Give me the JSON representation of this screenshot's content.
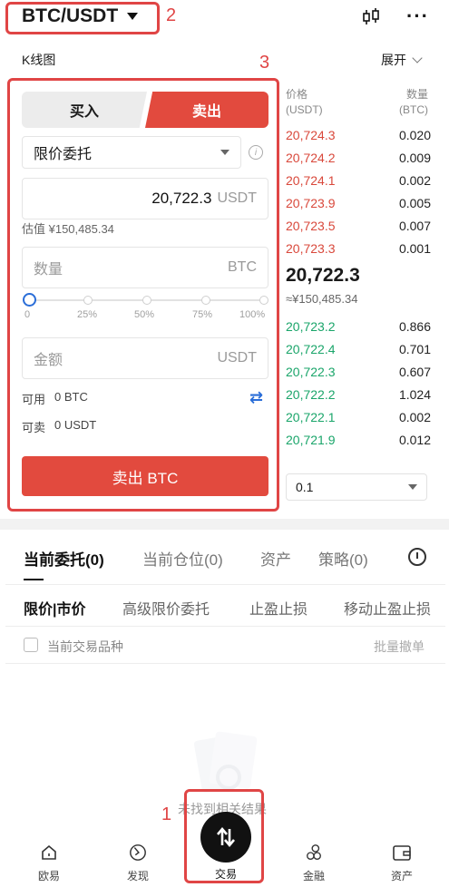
{
  "header": {
    "pair": "BTC/USDT",
    "icons": [
      "candlestick-icon",
      "more-icon"
    ]
  },
  "toolbar": {
    "kline": "K线图",
    "expand": "展开"
  },
  "trade": {
    "tab_buy": "买入",
    "tab_sell": "卖出",
    "order_type": "限价委托",
    "price_value": "20,722.3",
    "price_unit": "USDT",
    "estimate": "估值 ¥150,485.34",
    "qty_placeholder": "数量",
    "qty_unit": "BTC",
    "slider_ticks": [
      "0",
      "25%",
      "50%",
      "75%",
      "100%"
    ],
    "slider_value": 0,
    "amount_placeholder": "金额",
    "amount_unit": "USDT",
    "available_label": "可用",
    "available_value": "0 BTC",
    "sellable_label": "可卖",
    "sellable_value": "0 USDT",
    "submit": "卖出 BTC"
  },
  "orderbook": {
    "price_header": "价格",
    "price_header_unit": "(USDT)",
    "qty_header": "数量",
    "qty_header_unit": "(BTC)",
    "asks": [
      {
        "price": "20,724.3",
        "qty": "0.020"
      },
      {
        "price": "20,724.2",
        "qty": "0.009"
      },
      {
        "price": "20,724.1",
        "qty": "0.002"
      },
      {
        "price": "20,723.9",
        "qty": "0.005"
      },
      {
        "price": "20,723.5",
        "qty": "0.007"
      },
      {
        "price": "20,723.3",
        "qty": "0.001"
      }
    ],
    "last_price": "20,722.3",
    "last_cny": "≈¥150,485.34",
    "bids": [
      {
        "price": "20,723.2",
        "qty": "0.866"
      },
      {
        "price": "20,722.4",
        "qty": "0.701"
      },
      {
        "price": "20,722.3",
        "qty": "0.607"
      },
      {
        "price": "20,722.2",
        "qty": "1.024"
      },
      {
        "price": "20,722.1",
        "qty": "0.002"
      },
      {
        "price": "20,721.9",
        "qty": "0.012"
      }
    ],
    "depth": "0.1"
  },
  "orders": {
    "tabs": [
      "当前委托(0)",
      "当前仓位(0)",
      "资产",
      "策略(0)"
    ],
    "subtabs": [
      "限价|市价",
      "高级限价委托",
      "止盈止损",
      "移动止盈止损"
    ],
    "filter_label": "当前交易品种",
    "batch_cancel": "批量撤单",
    "empty": "未找到相关结果"
  },
  "nav": {
    "items": [
      "欧易",
      "发现",
      "交易",
      "金融",
      "资产"
    ]
  },
  "annotations": [
    "1",
    "2",
    "3"
  ],
  "colors": {
    "sell": "#e24a3e",
    "ask": "#d9483b",
    "bid": "#1aa56a",
    "accent": "#2b6ed8"
  }
}
